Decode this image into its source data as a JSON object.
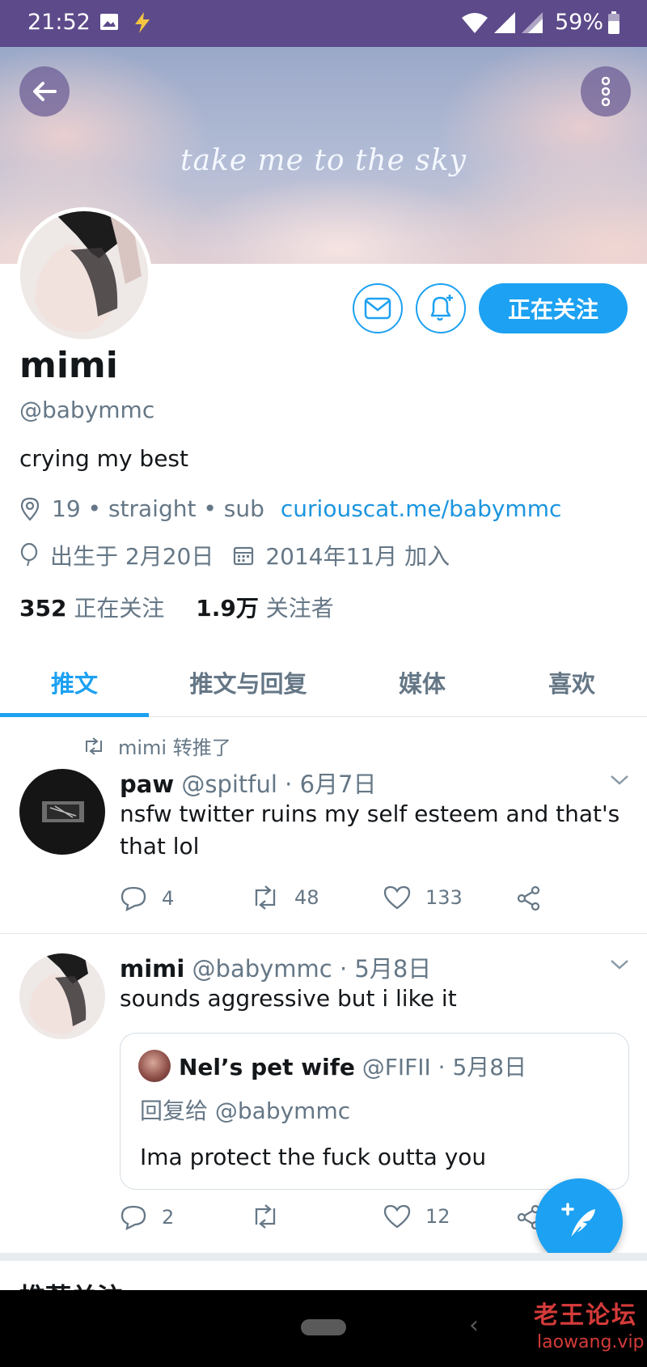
{
  "status_bar": {
    "time": "21:52",
    "battery": "59%"
  },
  "banner": {
    "slogan": "take me to the sky"
  },
  "header": {
    "follow_label": "正在关注"
  },
  "profile": {
    "name": "mimi",
    "handle": "@babymmc",
    "bio": "crying my best",
    "location": "19 • straight • sub",
    "link": "curiouscat.me/babymmc",
    "birthday": "出生于 2月20日",
    "joined": "2014年11月 加入",
    "following_count": "352",
    "following_label": "正在关注",
    "followers_count": "1.9万",
    "followers_label": "关注者"
  },
  "tabs": [
    {
      "label": "推文"
    },
    {
      "label": "推文与回复"
    },
    {
      "label": "媒体"
    },
    {
      "label": "喜欢"
    }
  ],
  "tweets": [
    {
      "retweet_note": "mimi 转推了",
      "name": "paw",
      "meta": "@spitful · 6月7日",
      "text": "nsfw twitter ruins my self esteem and that's that lol",
      "replies": "4",
      "retweets": "48",
      "likes": "133"
    },
    {
      "name": "mimi",
      "meta": "@babymmc · 5月8日",
      "text": "sounds aggressive but i like it",
      "replies": "2",
      "retweets": "",
      "likes": "12",
      "quote": {
        "name": "Nel’s pet wife",
        "meta": "@FIFII · 5月8日",
        "reply_to": "回复给 @babymmc",
        "text": "Ima protect the fuck outta you"
      }
    }
  ],
  "section_partial": "推荐关注",
  "watermark": {
    "cn": "老王论坛",
    "en": "laowang.vip"
  },
  "colors": {
    "accent": "#1da1f2",
    "status_bar": "#5c4a8a",
    "muted": "#657786"
  }
}
